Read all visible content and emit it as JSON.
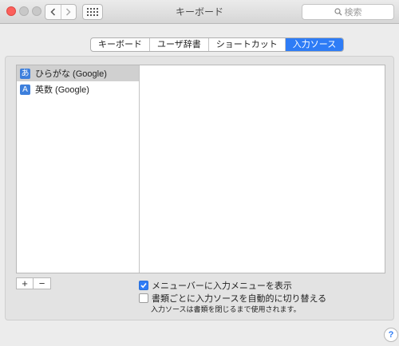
{
  "window": {
    "title": "キーボード",
    "search_placeholder": "検索",
    "traffic_colors": {
      "close": "#fc605c",
      "minimize": "#c8c8c8",
      "zoom": "#c8c8c8"
    },
    "icons": [
      "chevron-left-icon",
      "chevron-right-icon",
      "grid-icon",
      "search-icon"
    ]
  },
  "tabs": [
    {
      "label": "キーボード",
      "active": false
    },
    {
      "label": "ユーザ辞書",
      "active": false
    },
    {
      "label": "ショートカット",
      "active": false
    },
    {
      "label": "入力ソース",
      "active": true
    }
  ],
  "input_sources": [
    {
      "icon_char": "あ",
      "label": "ひらがな (Google)",
      "selected": true
    },
    {
      "icon_char": "A",
      "label": "英数 (Google)",
      "selected": false
    }
  ],
  "list_controls": {
    "add_label": "+",
    "remove_label": "−"
  },
  "options": {
    "show_menu": {
      "label": "メニューバーに入力メニューを表示",
      "checked": true
    },
    "auto_switch": {
      "label": "書類ごとに入力ソースを自動的に切り替える",
      "checked": false
    },
    "note": "入力ソースは書類を閉じるまで使用されます。"
  },
  "help_label": "?",
  "accent_color": "#2e7cf6"
}
